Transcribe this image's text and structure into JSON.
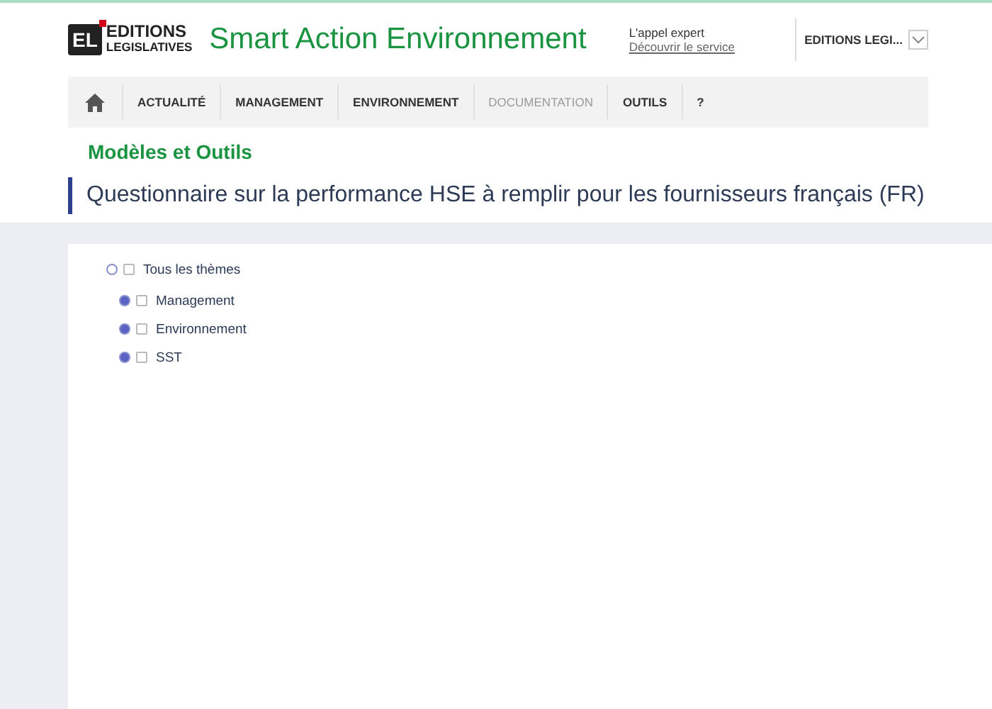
{
  "brand": {
    "mark": "EL",
    "line_1": "EDITIONS",
    "line_2": "LEGISLATIVES",
    "site_title": "Smart Action Environnement"
  },
  "expert": {
    "label": "L'appel expert",
    "link": "Découvrir le service"
  },
  "account": {
    "name": "EDITIONS LEGI..."
  },
  "nav": [
    {
      "label": "ACTUALITÉ",
      "disabled": false
    },
    {
      "label": "MANAGEMENT",
      "disabled": false
    },
    {
      "label": "ENVIRONNEMENT",
      "disabled": false
    },
    {
      "label": "DOCUMENTATION",
      "disabled": true
    },
    {
      "label": "OUTILS",
      "disabled": false
    },
    {
      "label": "?",
      "disabled": false
    }
  ],
  "section": "Modèles et Outils",
  "page_title": "Questionnaire sur la performance HSE à remplir pour les fournisseurs français (FR)",
  "tree": [
    {
      "label": "Tous les thèmes",
      "expanded": true,
      "checked": false,
      "children": [
        {
          "label": "Management",
          "expanded": false,
          "checked": false
        },
        {
          "label": "Environnement",
          "expanded": false,
          "checked": false
        },
        {
          "label": "SST",
          "expanded": false,
          "checked": false
        }
      ]
    }
  ]
}
